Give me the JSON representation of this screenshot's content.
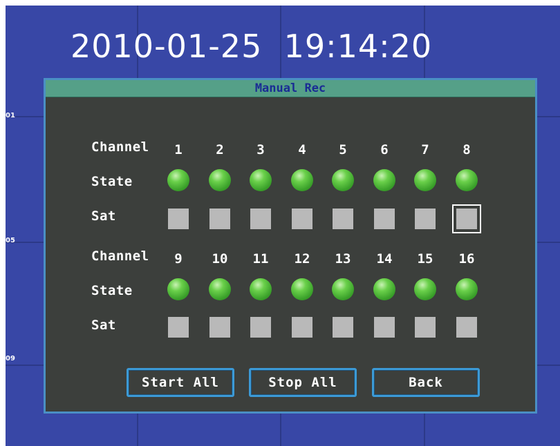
{
  "clock": "2010-01-25  19:14:20",
  "camera_labels": [
    "01",
    "05",
    "09"
  ],
  "dialog": {
    "title": "Manual Rec",
    "group1": {
      "channel_label": "Channel",
      "state_label": "State",
      "sat_label": "Sat",
      "channels": [
        "1",
        "2",
        "3",
        "4",
        "5",
        "6",
        "7",
        "8"
      ]
    },
    "group2": {
      "channel_label": "Channel",
      "state_label": "State",
      "sat_label": "Sat",
      "channels": [
        "9",
        "10",
        "11",
        "12",
        "13",
        "14",
        "15",
        "16"
      ]
    },
    "buttons": {
      "start_all": "Start All",
      "stop_all": "Stop All",
      "back": "Back"
    },
    "state_color": "#4cbf3a",
    "sat_color": "#b9b9b9"
  }
}
